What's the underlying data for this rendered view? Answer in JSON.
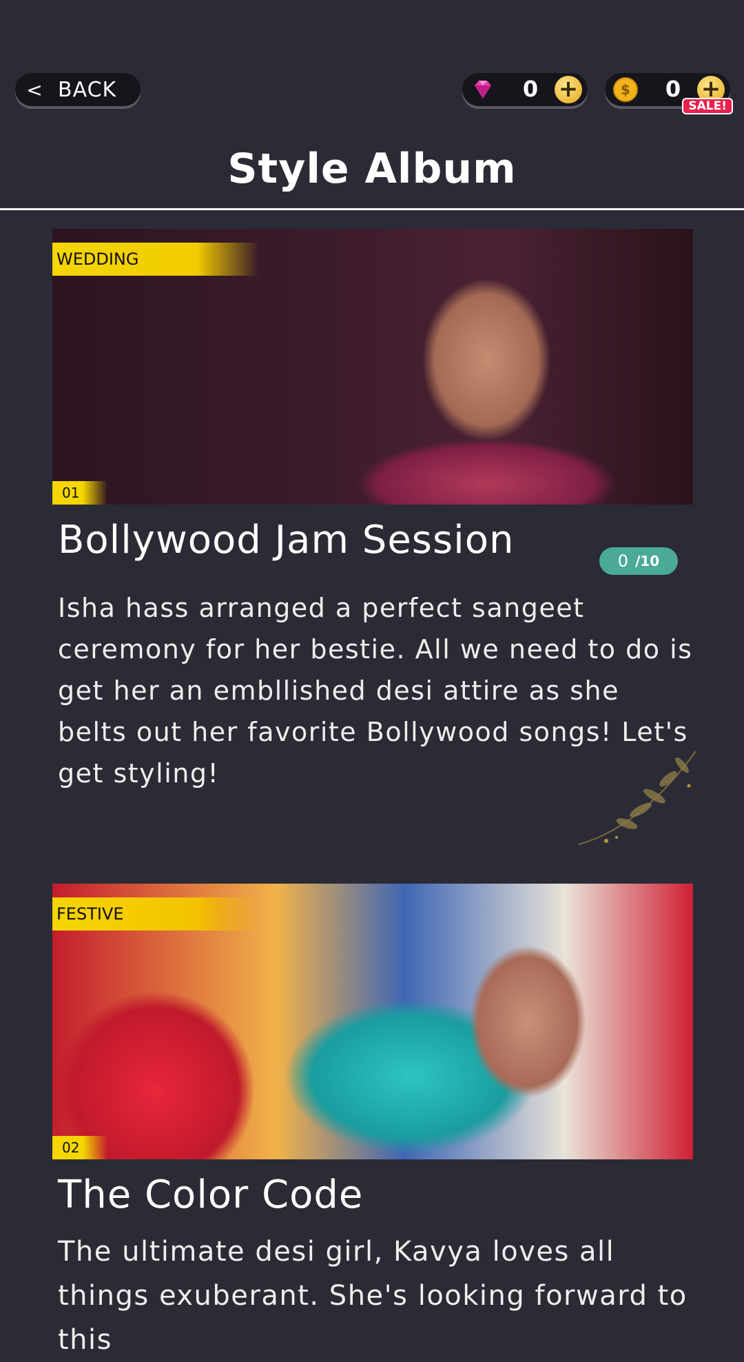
{
  "header": {
    "back_label": "BACK",
    "gems": "0",
    "coins": "0",
    "sale_badge": "SALE!",
    "title": "Style Album"
  },
  "colors": {
    "background": "#2b2b36",
    "tag_yellow": "#f5d600",
    "progress_teal": "#4aaa97",
    "sale_red": "#e8214c"
  },
  "albums": [
    {
      "tag": "WEDDING",
      "number": "01",
      "title": "Bollywood Jam Session",
      "progress_current": "0",
      "progress_total": "/10",
      "description": "Isha hass arranged a perfect sangeet ceremony for her bestie. All we need to do is get her an embllished desi attire as she belts out her favorite Bollywood songs! Let's get styling!"
    },
    {
      "tag": "FESTIVE",
      "number": "02",
      "title": "The Color Code",
      "description": "The ultimate desi girl, Kavya loves all things exuberant. She's looking forward to this"
    }
  ]
}
